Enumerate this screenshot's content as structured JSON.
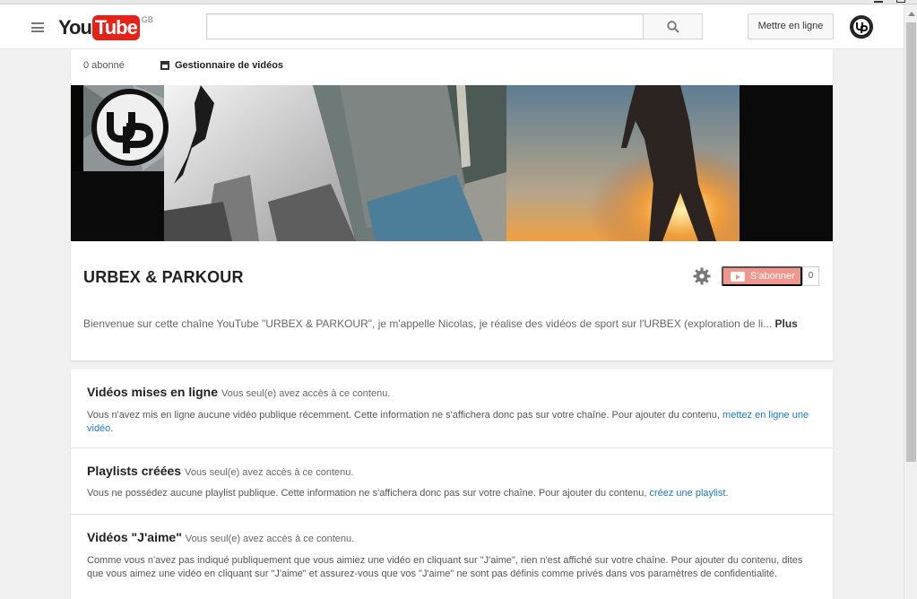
{
  "masthead": {
    "logo_you": "You",
    "logo_tube": "Tube",
    "country": "GB",
    "search_value": "",
    "upload_label": "Mettre en ligne"
  },
  "channel": {
    "subscribers": "0 abonné",
    "video_manager": "Gestionnaire de vidéos",
    "banner_logo_text": "UP",
    "title": "URBEX & PARKOUR",
    "subscribe_label": "S'abonner",
    "subscribe_count": "0",
    "description": "Bienvenue sur cette chaîne YouTube \"URBEX & PARKOUR\", je m'appelle Nicolas, je réalise des vidéos de sport sur l'URBEX (exploration de li...",
    "more_label": "Plus"
  },
  "sections": [
    {
      "title": "Vidéos mises en ligne",
      "note": "Vous seul(e) avez accès à ce contenu.",
      "text": "Vous n'avez mis en ligne aucune vidéo publique récemment. Cette information ne s'affichera donc pas sur votre chaîne. Pour ajouter du contenu,",
      "link": "mettez en ligne une vidéo",
      "end": "."
    },
    {
      "title": "Playlists créées",
      "note": "Vous seul(e) avez accès à ce contenu.",
      "text": "Vous ne possédez aucune playlist publique. Cette information ne s'affichera donc pas sur votre chaîne. Pour ajouter du contenu,",
      "link": "créez une playlist",
      "end": "."
    },
    {
      "title": "Vidéos \"J'aime\"",
      "note": "Vous seul(e) avez accès à ce contenu.",
      "text": "Comme vous n'avez pas indiqué publiquement que vous aimiez une vidéo en cliquant sur \"J'aime\", rien n'est affiché sur votre chaîne. Pour ajouter du contenu, dites que vous aimez une vidéo en cliquant sur \"J'aime\" et assurez-vous que vos \"J'aime\" ne sont pas définis comme privés dans vos paramètres de confidentialité."
    }
  ],
  "colors": {
    "brand_red": "#e62117",
    "subscribe_bg": "#f2958d",
    "link": "#167ac6"
  }
}
